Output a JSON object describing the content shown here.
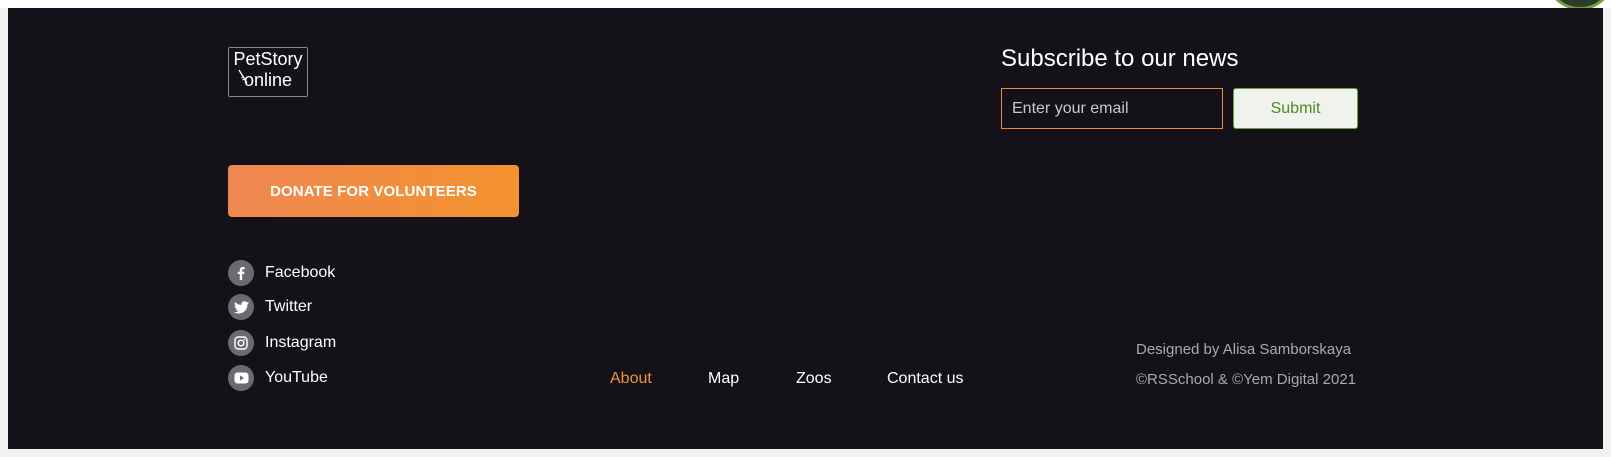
{
  "logo": {
    "line1": "PetStory",
    "line2": "online"
  },
  "donate_button": {
    "label": "DONATE FOR VOLUNTEERS"
  },
  "social": [
    {
      "label": "Facebook",
      "icon": "facebook-icon"
    },
    {
      "label": "Twitter",
      "icon": "twitter-icon"
    },
    {
      "label": "Instagram",
      "icon": "instagram-icon"
    },
    {
      "label": "YouTube",
      "icon": "youtube-icon"
    }
  ],
  "subscribe": {
    "title": "Subscribe to our news",
    "email_placeholder": "Enter your email",
    "email_value": "",
    "submit_label": "Submit"
  },
  "nav": {
    "items": [
      {
        "label": "About",
        "active": true
      },
      {
        "label": "Map",
        "active": false
      },
      {
        "label": "Zoos",
        "active": false
      },
      {
        "label": "Contact us",
        "active": false
      }
    ]
  },
  "credits": {
    "designer": "Designed by Alisa Samborskaya",
    "copyright": "©RSSchool & ©Yem Digital 2021"
  },
  "colors": {
    "footer_bg": "#141218",
    "accent_orange": "#f0923a",
    "submit_green": "#4e8a1f",
    "muted_text": "#a9a9ae"
  }
}
